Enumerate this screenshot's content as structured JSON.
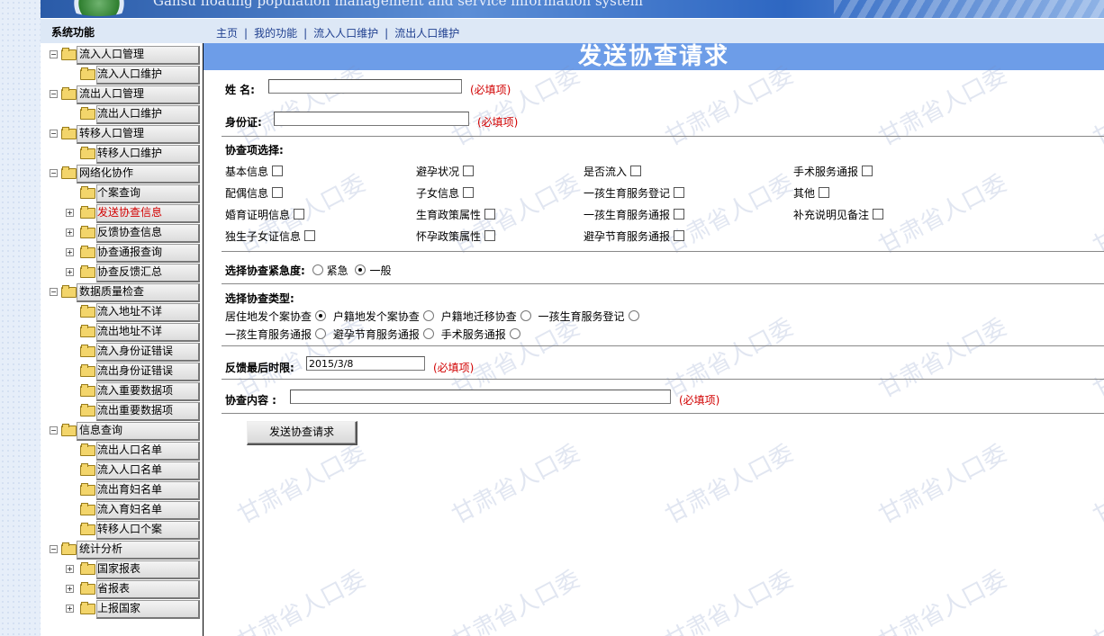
{
  "header": {
    "banner_text": "Gansu floating population management and service information system"
  },
  "nav": {
    "sys_label": "系统功能",
    "links": [
      "主页",
      "我的功能",
      "流入人口维护",
      "流出人口维护"
    ]
  },
  "sidebar": {
    "items": [
      {
        "label": "流入人口管理",
        "level": 1
      },
      {
        "label": "流入人口维护",
        "level": 2
      },
      {
        "label": "流出人口管理",
        "level": 1
      },
      {
        "label": "流出人口维护",
        "level": 2
      },
      {
        "label": "转移人口管理",
        "level": 1
      },
      {
        "label": "转移人口维护",
        "level": 2
      },
      {
        "label": "网络化协作",
        "level": 1
      },
      {
        "label": "个案查询",
        "level": 2
      },
      {
        "label": "发送协查信息",
        "level": 2,
        "active": true
      },
      {
        "label": "反馈协查信息",
        "level": 2
      },
      {
        "label": "协查通报查询",
        "level": 2
      },
      {
        "label": "协查反馈汇总",
        "level": 2
      },
      {
        "label": "数据质量检查",
        "level": 1
      },
      {
        "label": "流入地址不详",
        "level": 2
      },
      {
        "label": "流出地址不详",
        "level": 2
      },
      {
        "label": "流入身份证错误",
        "level": 2
      },
      {
        "label": "流出身份证错误",
        "level": 2
      },
      {
        "label": "流入重要数据项",
        "level": 2
      },
      {
        "label": "流出重要数据项",
        "level": 2
      },
      {
        "label": "信息查询",
        "level": 1
      },
      {
        "label": "流出人口名单",
        "level": 2
      },
      {
        "label": "流入人口名单",
        "level": 2
      },
      {
        "label": "流出育妇名单",
        "level": 2
      },
      {
        "label": "流入育妇名单",
        "level": 2
      },
      {
        "label": "转移人口个案",
        "level": 2
      },
      {
        "label": "统计分析",
        "level": 1
      },
      {
        "label": "国家报表",
        "level": 2
      },
      {
        "label": "省报表",
        "level": 2
      },
      {
        "label": "上报国家",
        "level": 2
      }
    ]
  },
  "form": {
    "title": "发送协查请求",
    "watermark": "甘肃省人口委",
    "name_label": "姓  名:",
    "id_label": "身份证:",
    "required_text": "(必填项)",
    "items_label": "协查项选择:",
    "checkboxes": [
      [
        "基本信息",
        "避孕状况",
        "是否流入",
        "手术服务通报"
      ],
      [
        "配偶信息",
        "子女信息",
        "一孩生育服务登记",
        "其他"
      ],
      [
        "婚育证明信息",
        "生育政策属性",
        "一孩生育服务通报",
        "补充说明见备注"
      ],
      [
        "独生子女证信息",
        "怀孕政策属性",
        "避孕节育服务通报"
      ]
    ],
    "urgency_label": "选择协查紧急度:",
    "urgency_options": [
      "紧急",
      "一般"
    ],
    "urgency_selected": "一般",
    "type_label": "选择协查类型:",
    "type_row1": [
      "居住地发个案协查",
      "户籍地发个案协查",
      "户籍地迁移协查",
      "一孩生育服务登记"
    ],
    "type_row2": [
      "一孩生育服务通报",
      "避孕节育服务通报",
      "手术服务通报"
    ],
    "type_selected": "居住地发个案协查",
    "deadline_label": "反馈最后时限:",
    "deadline_value": "2015/3/8",
    "content_label": "协查内容 :",
    "send_button": "发送协查请求"
  }
}
